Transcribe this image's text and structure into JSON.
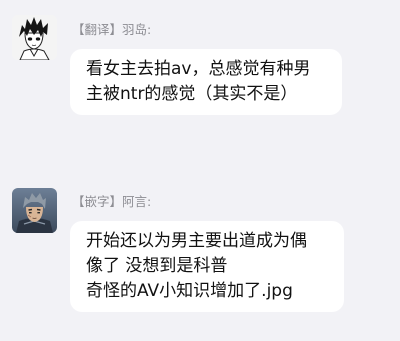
{
  "colors": {
    "background": "#f2f2f6",
    "bubble": "#ffffff",
    "sender_text": "#8d8d93",
    "message_text": "#111111"
  },
  "messages": [
    {
      "avatar_icon": "manga-boy-avatar-icon",
      "sender": "【翻译】羽岛:",
      "lines": [
        "看女主去拍av，总感觉有种男",
        "主被ntr的感觉（其实不是）"
      ]
    },
    {
      "avatar_icon": "armored-man-avatar-icon",
      "sender": "【嵌字】阿言:",
      "lines": [
        "开始还以为男主要出道成为偶",
        "像了 没想到是科普",
        "奇怪的AV小知识增加了.jpg"
      ]
    }
  ]
}
